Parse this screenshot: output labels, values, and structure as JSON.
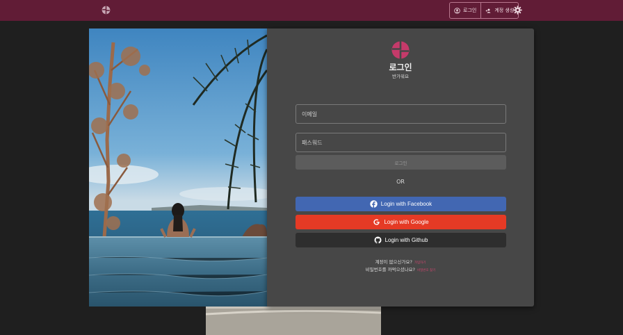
{
  "header": {
    "login_label": "로그인",
    "signup_label": "계정 생성"
  },
  "card": {
    "title": "로그인",
    "subtitle": "반가워요",
    "email_placeholder": "이메일",
    "password_placeholder": "패스워드",
    "login_button": "로그인",
    "divider": "OR",
    "facebook_label": "Login with Facebook",
    "google_label": "Login with Google",
    "github_label": "Login with Github",
    "no_account_text": "계정이 없으신가요?",
    "signup_link": "가입하기",
    "forgot_text": "비밀번호를 까먹으셨나요?",
    "find_password_link": "비밀번호 찾기"
  },
  "colors": {
    "topbar": "#611c36",
    "brand": "#c53a6a",
    "facebook": "#4267b2",
    "google": "#e53a25",
    "github": "#2e2e2e"
  },
  "icons": [
    "brand-logo-icon",
    "user-circle-icon",
    "add-user-icon",
    "gear-icon",
    "facebook-icon",
    "google-icon",
    "github-icon"
  ]
}
